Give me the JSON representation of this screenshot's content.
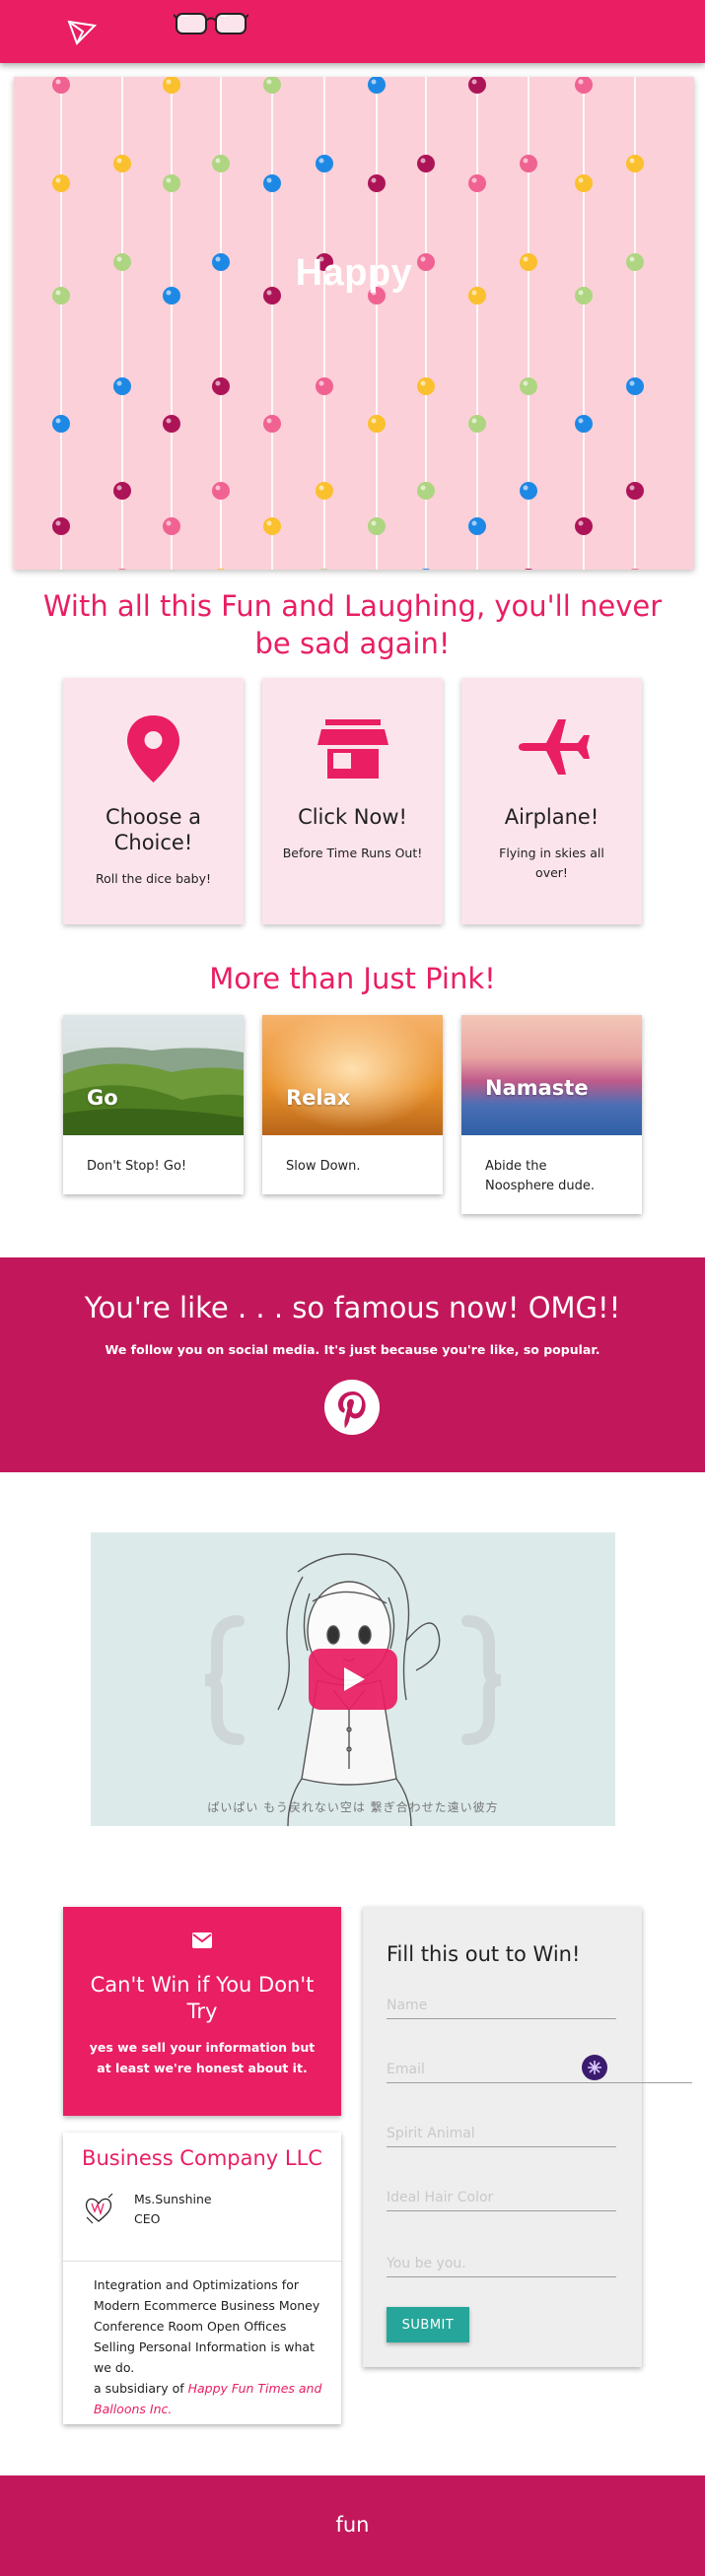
{
  "hero": {
    "title": "Happy"
  },
  "headline_fun": "With all this Fun and Laughing, you'll never be sad again!",
  "feature_cards": [
    {
      "icon": "location-pin-icon",
      "title": "Choose a Choice!",
      "subtitle": "Roll the dice baby!"
    },
    {
      "icon": "store-icon",
      "title": "Click Now!",
      "subtitle": "Before Time Runs Out!"
    },
    {
      "icon": "airplane-icon",
      "title": "Airplane!",
      "subtitle": "Flying in skies all over!"
    }
  ],
  "headline_pink": "More than Just Pink!",
  "image_cards": [
    {
      "label": "Go",
      "text": "Don't Stop! Go!"
    },
    {
      "label": "Relax",
      "text": "Slow Down."
    },
    {
      "label": "Namaste",
      "text": "Abide the Noosphere dude."
    }
  ],
  "social": {
    "title": "You're like . . . so famous now! OMG!!",
    "subtitle": "We follow you on social media. It's just because you're like, so popular.",
    "icon": "pinterest-icon"
  },
  "video": {
    "subtitle": "ぱいぱい もう戻れない空は 繋ぎ合わせた遠い彼方"
  },
  "contact_card": {
    "title": "Can't Win if You Don't Try",
    "subtitle": "yes we sell your information but at least we're honest about it."
  },
  "form": {
    "title": "Fill this out to Win!",
    "fields": [
      {
        "placeholder": "Name"
      },
      {
        "placeholder": "Email"
      },
      {
        "placeholder": "Spirit Animal"
      },
      {
        "placeholder": "Ideal Hair Color"
      },
      {
        "placeholder": "You be you."
      }
    ],
    "submit_label": "SUBMIT"
  },
  "business": {
    "company": "Business Company LLC",
    "person_name": "Ms.Sunshine",
    "person_role": "CEO",
    "description": "Integration and Optimizations for Modern Ecommerce Business Money Conference Room Open Offices Selling Personal Information is what we do.",
    "subsidiary_prefix": "a subsidiary of",
    "subsidiary_link": "Happy Fun Times and Balloons Inc."
  },
  "footer": {
    "label": "fun"
  },
  "colors": {
    "primary": "#e91e63",
    "dark_pink": "#c2185b",
    "card_pink": "#fce4ec",
    "teal": "#26a69a"
  }
}
